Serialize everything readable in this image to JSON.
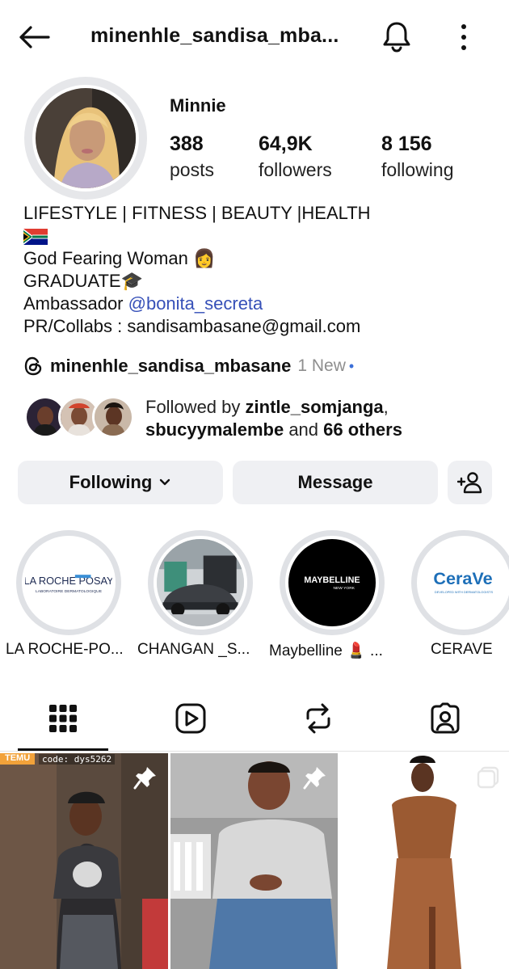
{
  "header": {
    "username": "minenhle_sandisa_mba..."
  },
  "profile": {
    "display_name": "Minnie",
    "stats": [
      {
        "value": "388",
        "label": "posts"
      },
      {
        "value": "64,9K",
        "label": "followers"
      },
      {
        "value": "8 156",
        "label": "following"
      }
    ]
  },
  "bio": {
    "line1": "LIFESTYLE | FITNESS | BEAUTY |HEALTH",
    "line3": "God Fearing Woman",
    "line3_emoji": "👩",
    "line4": "GRADUATE",
    "line4_emoji": "🎓",
    "line5_prefix": "Ambassador ",
    "line5_mention": "@bonita_secreta",
    "line6": "PR/Collabs : sandisambasane@gmail.com"
  },
  "threads": {
    "handle": "minenhle_sandisa_mbasane",
    "new_label": "1 New",
    "dot": "•"
  },
  "followed_by": {
    "prefix": "Followed by ",
    "user1": "zintle_somjanga",
    "sep": ",",
    "user2": "sbucyymalembe",
    "middle": " and ",
    "others": "66 others"
  },
  "actions": {
    "following_label": "Following",
    "message_label": "Message"
  },
  "highlights": [
    {
      "label": "LA ROCHE-PO...",
      "logo_text_1": "LA ROCHE POSAY",
      "logo_text_2": "LABORATOIRE DERMATOLOGIQUE"
    },
    {
      "label": "CHANGAN _S..."
    },
    {
      "label": "Maybelline 💄 ...",
      "logo_text_1": "MAYBELLINE",
      "logo_text_2": "NEW YORK"
    },
    {
      "label": "CERAVE",
      "logo_text_1": "CeraVe",
      "logo_text_2": "DEVELOPED WITH DERMATOLOGISTS"
    }
  ],
  "grid": {
    "post1_badge": "TEMU",
    "post1_code": "code: dys5262"
  },
  "colors": {
    "link": "#3650b8",
    "button_bg": "#eff0f3",
    "threads_dot": "#3b6fd8"
  },
  "icons": [
    "back-arrow-icon",
    "bell-icon",
    "more-vertical-icon",
    "threads-icon",
    "chevron-down-icon",
    "add-person-icon",
    "grid-icon",
    "reels-icon",
    "reposts-icon",
    "tagged-icon",
    "pin-icon",
    "multi-post-icon"
  ]
}
